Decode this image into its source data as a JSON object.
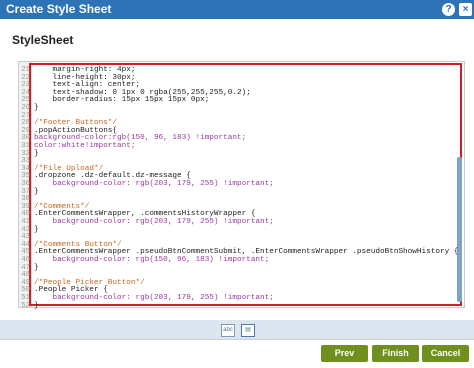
{
  "window": {
    "title": "Create Style Sheet",
    "help_label": "?",
    "close_label": "×"
  },
  "heading": "StyleSheet",
  "editor": {
    "lines": [
      {
        "n": "21",
        "text": "    margin-right: 4px;",
        "cls": "c-text"
      },
      {
        "n": "22",
        "text": "    line-height: 30px;",
        "cls": "c-text"
      },
      {
        "n": "23",
        "text": "    text-align: center;",
        "cls": "c-text"
      },
      {
        "n": "24",
        "text": "    text-shadow: 0 1px 0 rgba(255,255,255,0.2);",
        "cls": "c-text"
      },
      {
        "n": "25",
        "text": "    border-radius: 15px 15px 15px 0px;",
        "cls": "c-text"
      },
      {
        "n": "26",
        "text": "}",
        "cls": "c-text"
      },
      {
        "n": "27",
        "text": "",
        "cls": "c-text"
      },
      {
        "n": "28",
        "text": "/*Footer Buttons*/",
        "cls": "c-comment"
      },
      {
        "n": "29",
        "text": ".popActionButtons{",
        "cls": "c-text"
      },
      {
        "n": "30",
        "text": "background-color:rgb(150, 96, 183) !important;",
        "cls": "c-value"
      },
      {
        "n": "31",
        "text": "color:white!important;",
        "cls": "c-value"
      },
      {
        "n": "32",
        "text": "}",
        "cls": "c-text"
      },
      {
        "n": "33",
        "text": "",
        "cls": "c-text"
      },
      {
        "n": "34",
        "text": "/*File Upload*/",
        "cls": "c-comment"
      },
      {
        "n": "35",
        "text": ".dropzone .dz-default.dz-message {",
        "cls": "c-text"
      },
      {
        "n": "36",
        "text": "    background-color: rgb(203, 179, 255) !important;",
        "cls": "c-value"
      },
      {
        "n": "37",
        "text": "}",
        "cls": "c-text"
      },
      {
        "n": "38",
        "text": "",
        "cls": "c-text"
      },
      {
        "n": "39",
        "text": "/*Comments*/",
        "cls": "c-comment"
      },
      {
        "n": "40",
        "text": ".EnterCommentsWrapper, .commentsHistoryWrapper {",
        "cls": "c-text"
      },
      {
        "n": "41",
        "text": "    background-color: rgb(203, 179, 255) !important;",
        "cls": "c-value"
      },
      {
        "n": "42",
        "text": "}",
        "cls": "c-text"
      },
      {
        "n": "43",
        "text": "",
        "cls": "c-text"
      },
      {
        "n": "44",
        "text": "/*Comments Button*/",
        "cls": "c-comment"
      },
      {
        "n": "45",
        "text": ".EnterCommentsWrapper .pseudoBtnCommentSubmit, .EnterCommentsWrapper .pseudoBtnShowHistory {",
        "cls": "c-text"
      },
      {
        "n": "46",
        "text": "    background-color: rgb(150, 96, 183) !important;",
        "cls": "c-value"
      },
      {
        "n": "47",
        "text": "}",
        "cls": "c-text"
      },
      {
        "n": "48",
        "text": "",
        "cls": "c-text"
      },
      {
        "n": "49",
        "text": "/*People Picker Button*/",
        "cls": "c-comment"
      },
      {
        "n": "50",
        "text": ".People Picker {",
        "cls": "c-text"
      },
      {
        "n": "51",
        "text": "    background-color: rgb(203, 179, 255) !important;",
        "cls": "c-value"
      },
      {
        "n": "52",
        "text": "}",
        "cls": "c-text"
      }
    ]
  },
  "footer_tabs": {
    "first_icon": "abc-icon",
    "second_icon": "document-icon"
  },
  "buttons": {
    "prev": "Prev",
    "finish": "Finish",
    "cancel": "Cancel"
  },
  "colors": {
    "titlebar": "#2d73b6",
    "button": "#6f8f1f",
    "highlight_border": "#d21f26"
  }
}
